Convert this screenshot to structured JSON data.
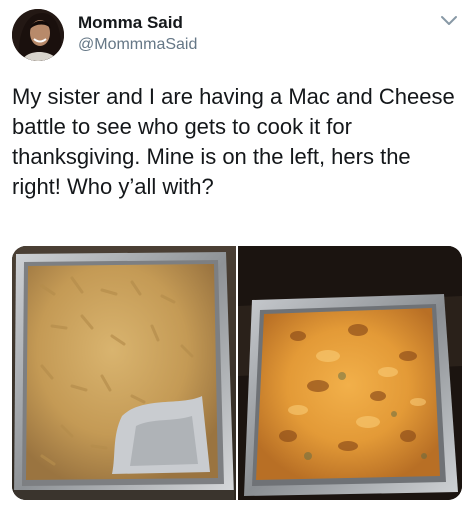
{
  "tweet": {
    "display_name": "Momma Said",
    "handle": "@MommmaSaid",
    "text": "My sister and I are having a Mac and Cheese battle to see who gets to cook it for thanksgiving. Mine is on the left, hers the right! Who y’all with?"
  },
  "icons": {
    "menu": "chevron-down-icon",
    "avatar": "user-avatar"
  },
  "colors": {
    "text_primary": "#14171a",
    "text_secondary": "#657786",
    "caret": "#8899a6"
  },
  "media": {
    "count": 2
  }
}
